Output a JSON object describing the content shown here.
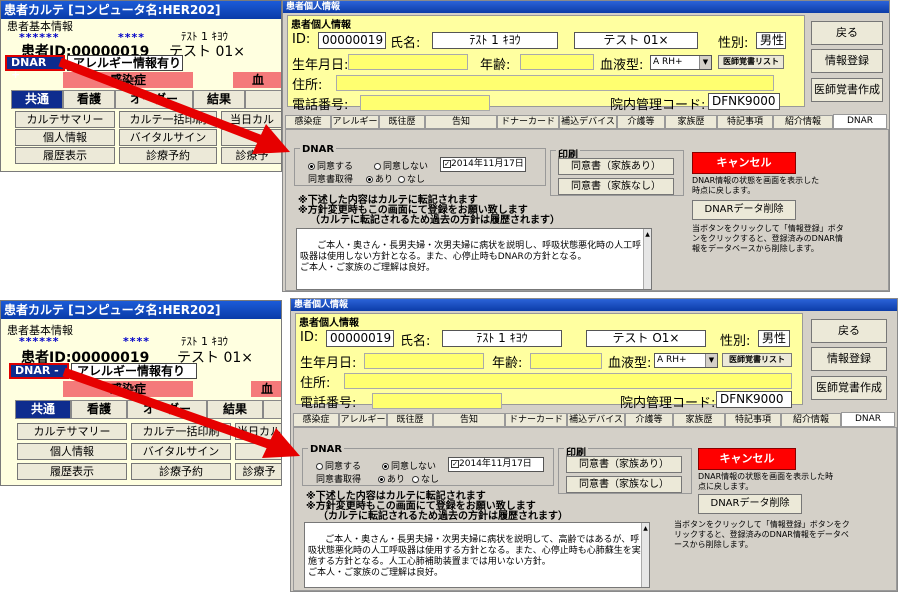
{
  "panels": [
    {
      "karte": {
        "title": "患者カルテ [コンピュータ名:HER202]",
        "group_label": "患者基本情報",
        "stars_left": "******",
        "stars_right": "****",
        "kana": "ﾃｽﾄ 1 ｷﾖｳ",
        "patient_id": "患者ID:00000019",
        "name": "テスト 01×",
        "dnar_button": "DNAR +",
        "allergy": "アレルギー情報有り",
        "infection": "感染症",
        "blood": "血",
        "tabs": [
          "共通",
          "看護",
          "オーダー",
          "結果"
        ],
        "buttons": [
          "カルテサマリー",
          "カルテ一括印刷",
          "当日カル",
          "個人情報",
          "バイタルサイン",
          "",
          "履歴表示",
          "診療予約",
          "診療予"
        ]
      },
      "info": {
        "title": "患者個人情報",
        "section": "患者個人情報",
        "id_label": "ID:",
        "id_value": "00000019",
        "name_label": "氏名:",
        "kana_value": "ﾃｽﾄ 1 ｷﾖｳ",
        "name_value": "テスト 01×",
        "sex_label": "性別:",
        "sex_value": "男性",
        "birth_label": "生年月日:",
        "age_label": "年齢:",
        "blood_label": "血液型:",
        "blood_value": "A RH+",
        "doctor_memo_list": "医師覚書リスト",
        "address_label": "住所:",
        "phone_label": "電話番号:",
        "mgmt_label": "院内管理コード:",
        "mgmt_value": "DFNK9000",
        "side_buttons": [
          "戻る",
          "情報登録",
          "医師覚書作成"
        ],
        "tabs": [
          "感染症",
          "アレルギー",
          "既往歴",
          "告知",
          "ドナーカード",
          "補込デバイス",
          "介護等",
          "家族歴",
          "特記事項",
          "紹介情報",
          "DNAR"
        ],
        "dnar_group": "DNAR",
        "radio_do": "同意する",
        "radio_dont": "同意しない",
        "date": "2014年11月17日",
        "consent_label": "同意書取得",
        "consent_yes": "あり",
        "consent_no": "なし",
        "print_group": "印刷",
        "print_with_family": "同意書（家族あり）",
        "print_without_family": "同意書（家族なし）",
        "cancel": "キャンセル",
        "cancel_note": "DNAR情報の状態を画面を表示した時点に戻します。",
        "note1": "※下述した内容はカルテに転記されます",
        "note2": "※方針変更時もこの画面にて登録をお願い致します",
        "note3": "（カルテに転記されるため過去の方針は履歴されます）",
        "delete_button": "DNARデータ削除",
        "delete_note": "当ボタンをクリックして「情報登録」ボタンをクリックすると、登録済みのDNAR情報をデータベースから削除します。",
        "memo": "ご本人・奥さん・長男夫婦・次男夫婦に病状を説明し、呼吸状態悪化時の人工呼吸器は使用しない方針となる。また、心停止時もDNARの方針となる。\nご本人・ご家族のご理解は良好。",
        "selected_radio": "do"
      }
    },
    {
      "karte": {
        "title": "患者カルテ [コンピュータ名:HER202]",
        "group_label": "患者基本情報",
        "stars_left": "******",
        "stars_right": "****",
        "kana": "ﾃｽﾄ 1 ｷﾖｳ",
        "patient_id": "患者ID:00000019",
        "name": "テスト 01×",
        "dnar_button": "DNAR -",
        "allergy": "アレルギー情報有り",
        "infection": "感染症",
        "blood": "血",
        "tabs": [
          "共通",
          "看護",
          "オーダー",
          "結果"
        ],
        "buttons": [
          "カルテサマリー",
          "カルテ一括印刷",
          "当日カル",
          "個人情報",
          "バイタルサイン",
          "",
          "履歴表示",
          "診療予約",
          "診療予"
        ]
      },
      "info": {
        "title": "患者個人情報",
        "section": "患者個人情報",
        "id_label": "ID:",
        "id_value": "00000019",
        "name_label": "氏名:",
        "kana_value": "ﾃｽﾄ 1 ｷﾖｳ",
        "name_value": "テスト O1×",
        "sex_label": "性別:",
        "sex_value": "男性",
        "birth_label": "生年月日:",
        "age_label": "年齢:",
        "blood_label": "血液型:",
        "blood_value": "A RH+",
        "doctor_memo_list": "医師覚書リスト",
        "address_label": "住所:",
        "phone_label": "電話番号:",
        "mgmt_label": "院内管理コード:",
        "mgmt_value": "DFNK9000",
        "side_buttons": [
          "戻る",
          "情報登録",
          "医師覚書作成"
        ],
        "tabs": [
          "感染症",
          "アレルギー",
          "既往歴",
          "告知",
          "ドナーカード",
          "補込デバイス",
          "介護等",
          "家族歴",
          "特記事項",
          "紹介情報",
          "DNAR"
        ],
        "dnar_group": "DNAR",
        "radio_do": "同意する",
        "radio_dont": "同意しない",
        "date": "2014年11月17日",
        "consent_label": "同意書取得",
        "consent_yes": "あり",
        "consent_no": "なし",
        "print_group": "印刷",
        "print_with_family": "同意書（家族あり）",
        "print_without_family": "同意書（家族なし）",
        "cancel": "キャンセル",
        "cancel_note": "DNAR情報の状態を画面を表示した時点に戻します。",
        "note1": "※下述した内容はカルテに転記されます",
        "note2": "※方針変更時もこの画面にて登録をお願い致します",
        "note3": "（カルテに転記されるため過去の方針は履歴されます）",
        "delete_button": "DNARデータ削除",
        "delete_note": "当ボタンをクリックして「情報登録」ボタンをクリックすると、登録済みのDNAR情報をデータベースから削除します。",
        "memo": "ご本人・奥さん・長男夫婦・次男夫婦に病状を説明して、高齢ではあるが、呼吸状態悪化時の人工呼吸器は使用する方針となる。また、心停止時も心肺蘇生を実施する方針となる。人工心肺補助装置までは用いない方針。\nご本人・ご家族のご理解は良好。",
        "selected_radio": "dont"
      }
    }
  ],
  "colors": {
    "arrow": "#e60000",
    "title_blue": "#0a3ca8",
    "yellow": "#ffffa0",
    "cancel_red": "#ff0000"
  }
}
